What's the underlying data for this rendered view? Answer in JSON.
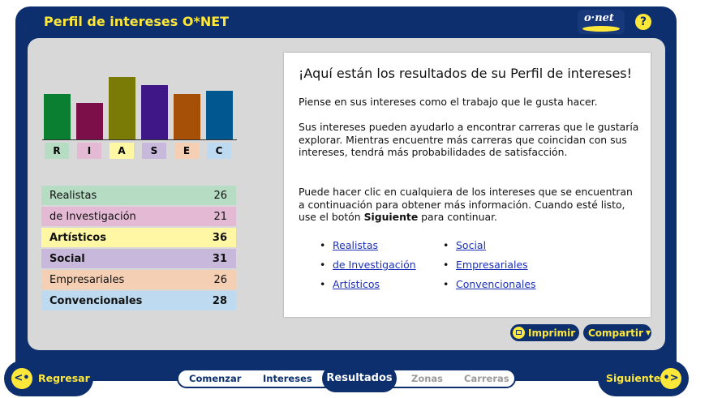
{
  "header": {
    "title": "Perfil de intereses O*NET",
    "logo_text": "o·net",
    "help_label": "?"
  },
  "colors": {
    "frame": "#0d2f6e",
    "accent_yellow": "#ffe83a",
    "realistic": "#0a7f31",
    "investigative": "#7c0f4a",
    "artistic": "#7a7a06",
    "social": "#3f1787",
    "enterprising": "#a64f06",
    "conventional": "#01578f"
  },
  "chart_data": {
    "type": "bar",
    "categories": [
      "R",
      "I",
      "A",
      "S",
      "E",
      "C"
    ],
    "values": [
      26,
      21,
      36,
      31,
      26,
      28
    ],
    "colors": [
      "#0a7f31",
      "#7c0f4a",
      "#7a7a06",
      "#3f1787",
      "#a64f06",
      "#01578f"
    ],
    "tick_colors": [
      "#b6dcc4",
      "#e3b9d3",
      "#fff7a4",
      "#c7b8dc",
      "#f4cfb4",
      "#bddaf0"
    ],
    "ylim": [
      0,
      40
    ]
  },
  "scores": [
    {
      "label": "Realistas",
      "value": "26",
      "bg": "#b6dcc4",
      "bold": false
    },
    {
      "label": "de Investigación",
      "value": "21",
      "bg": "#e3b9d3",
      "bold": false
    },
    {
      "label": "Artísticos",
      "value": "36",
      "bg": "#fff7a4",
      "bold": true
    },
    {
      "label": "Social",
      "value": "31",
      "bg": "#c7b8dc",
      "bold": true
    },
    {
      "label": "Empresariales",
      "value": "26",
      "bg": "#f4cfb4",
      "bold": false
    },
    {
      "label": "Convencionales",
      "value": "28",
      "bg": "#bddaf0",
      "bold": true
    }
  ],
  "content": {
    "heading": "¡Aquí están los resultados de su Perfil de intereses!",
    "para1": "Piense en sus intereses como el trabajo que le gusta hacer.",
    "para2": "Sus intereses pueden ayudarlo a encontrar carreras que le gustaría explorar. Mientras encuentre más carreras que coincidan con sus intereses, tendrá más probabilidades de satisfacción.",
    "para3_a": "Puede hacer clic en cualquiera de los intereses que se encuentran a continuación para obtener más información. Cuando esté listo, use el botón ",
    "para3_b": "Siguiente",
    "para3_c": " para continuar.",
    "links": [
      "Realistas",
      "de Investigación",
      "Artísticos",
      "Social",
      "Empresariales",
      "Convencionales"
    ]
  },
  "actions": {
    "print": "Imprimir",
    "share": "Compartir"
  },
  "nav": {
    "back": "Regresar",
    "next": "Siguiente",
    "steps": [
      "Comenzar",
      "Intereses",
      "Resultados",
      "Zonas",
      "Carreras"
    ],
    "active_step": "Resultados"
  }
}
